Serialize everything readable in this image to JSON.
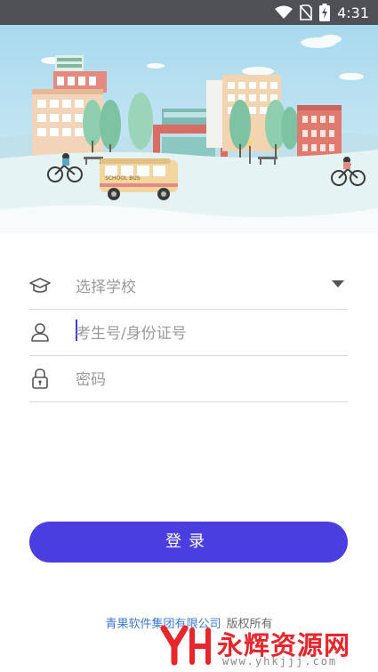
{
  "status_bar": {
    "time": "4:31"
  },
  "form": {
    "school_placeholder": "选择学校",
    "id_placeholder": "考生号/身份证号",
    "password_placeholder": "密码"
  },
  "banner": {
    "bus_text": "SCHOOL BUS"
  },
  "login_label": "登录",
  "footer": {
    "company": "青果软件集团有限公司",
    "rights": "版权所有"
  },
  "watermark": {
    "brand": "永辉资源网",
    "url": "www.yhkjjj.com"
  },
  "colors": {
    "primary": "#4a3ee0",
    "link": "#3d7ad8",
    "watermark": "#e8262b"
  }
}
